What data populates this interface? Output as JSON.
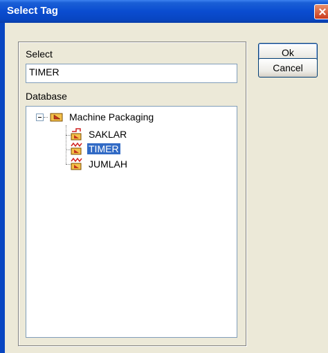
{
  "window": {
    "title": "Select Tag"
  },
  "form": {
    "select_label": "Select",
    "select_value": "TIMER",
    "database_label": "Database"
  },
  "tree": {
    "root": {
      "label": "Machine Packaging",
      "expanded": true
    },
    "items": [
      {
        "label": "SAKLAR",
        "selected": false,
        "icon": "digital-tag-icon"
      },
      {
        "label": "TIMER",
        "selected": true,
        "icon": "analog-tag-icon"
      },
      {
        "label": "JUMLAH",
        "selected": false,
        "icon": "analog-tag-icon"
      }
    ]
  },
  "buttons": {
    "ok": "Ok",
    "cancel": "Cancel"
  },
  "colors": {
    "titlebar": "#0a4cd0",
    "selection": "#316ac5",
    "dialog_bg": "#ece9d8",
    "field_border": "#7f9db9"
  }
}
